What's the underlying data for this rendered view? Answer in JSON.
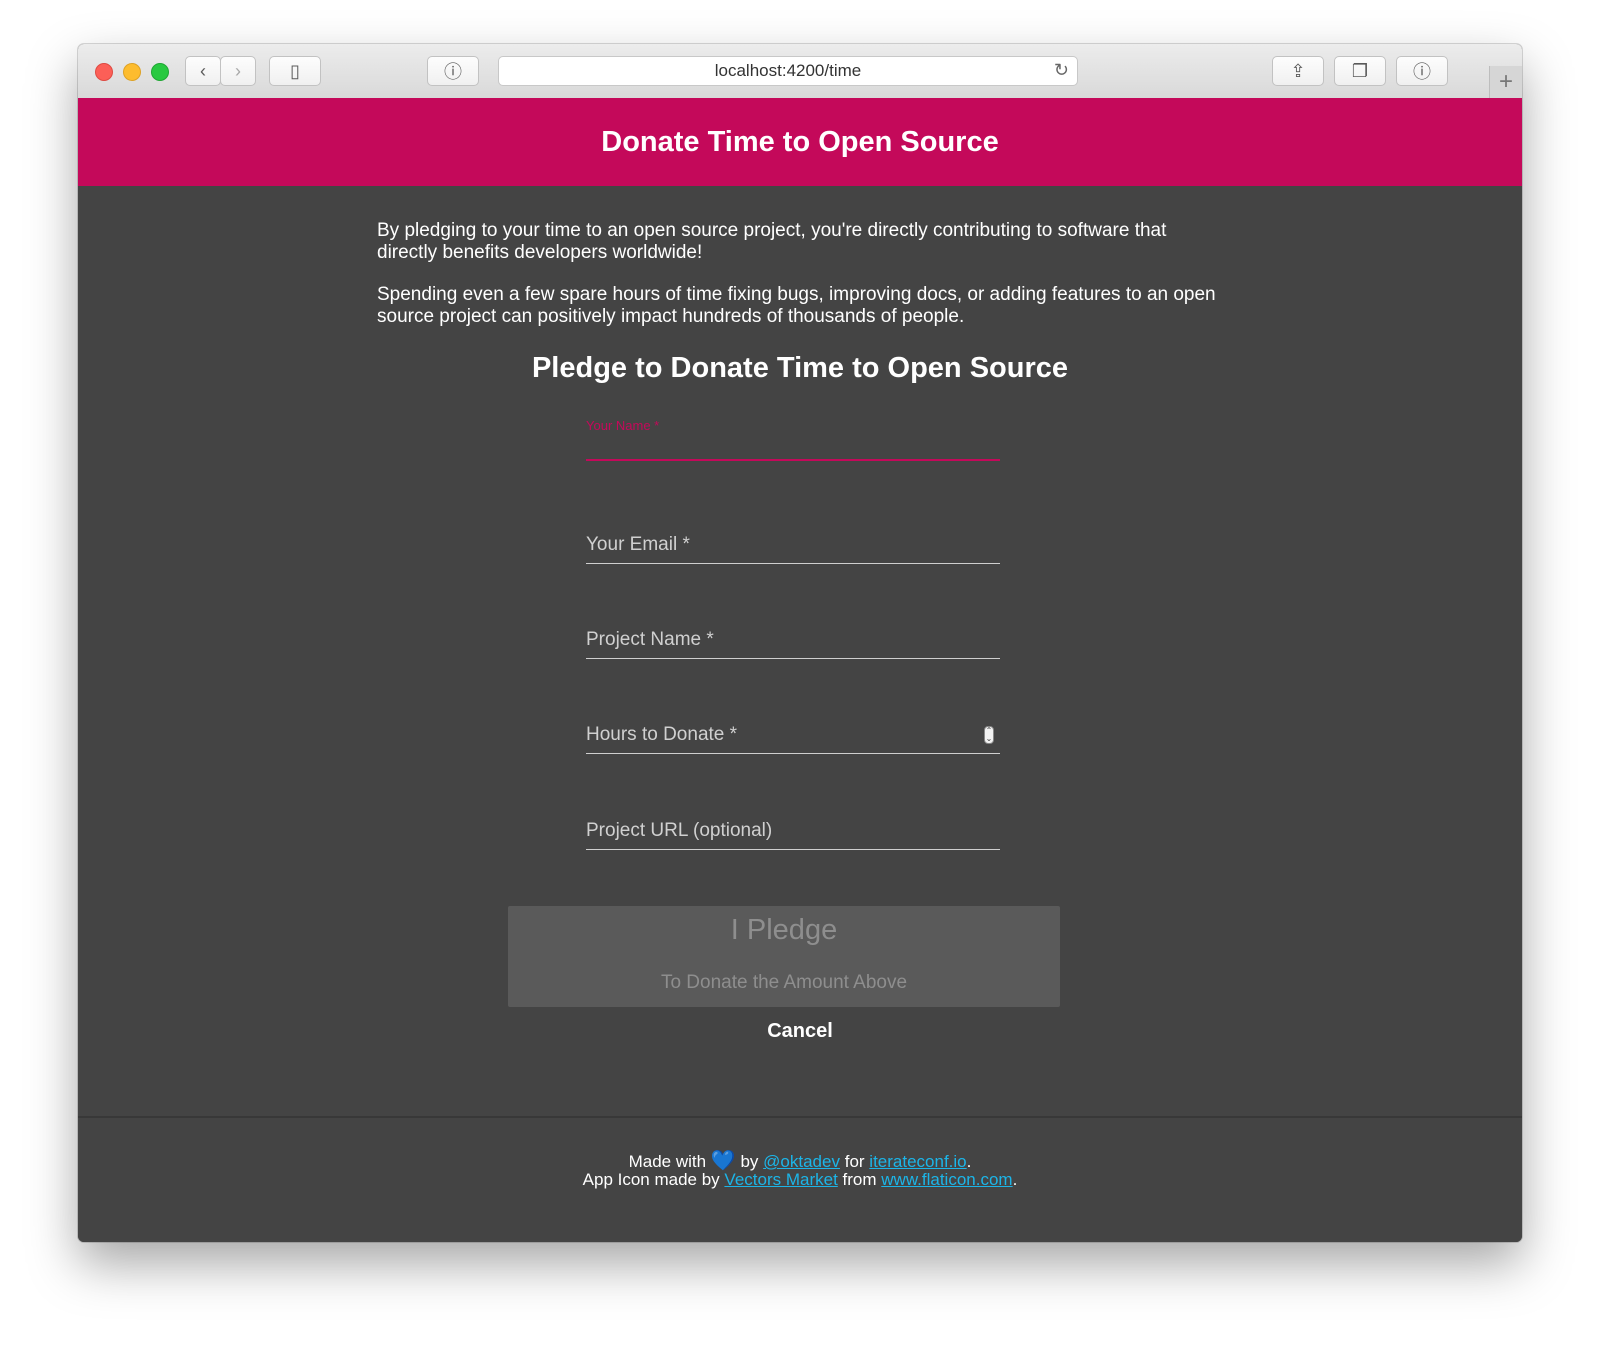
{
  "browser": {
    "url": "localhost:4200/time",
    "back_icon": "‹",
    "forward_icon": "›",
    "sidebar_icon": "▯",
    "privacy_icon": "ⓘ",
    "reload_icon": "↻",
    "share_icon": "⇪",
    "tabs_icon": "❐",
    "info_icon": "ⓘ",
    "new_tab_icon": "+"
  },
  "header": {
    "title": "Donate Time to Open Source"
  },
  "intro": {
    "p1": "By pledging to your time to an open source project, you're directly contributing to software that directly benefits developers worldwide!",
    "p2": "Spending even a few spare hours of time fixing bugs, improving docs, or adding features to an open source project can positively impact hundreds of thousands of people."
  },
  "form": {
    "title": "Pledge to Donate Time to Open Source",
    "fields": [
      {
        "label": "Your Name *",
        "value": ""
      },
      {
        "label": "Your Email *",
        "value": ""
      },
      {
        "label": "Project Name *",
        "value": ""
      },
      {
        "label": "Hours to Donate *",
        "value": ""
      },
      {
        "label": "Project URL (optional)",
        "value": ""
      }
    ],
    "pledge_label": "I Pledge",
    "pledge_sublabel": "To Donate the Amount Above",
    "cancel_label": "Cancel"
  },
  "footer": {
    "made_with": "Made with",
    "heart": "💙",
    "by": "by",
    "okta_link": "@oktadev",
    "for": "for",
    "iterate_link": "iterateconf.io",
    "period1": ".",
    "icon_text": "App Icon made by",
    "vectors_link": "Vectors Market",
    "from": "from",
    "flaticon_link": "www.flaticon.com",
    "period2": "."
  },
  "colors": {
    "accent": "#c4095a",
    "background": "#444444",
    "link": "#1cb5e8"
  }
}
